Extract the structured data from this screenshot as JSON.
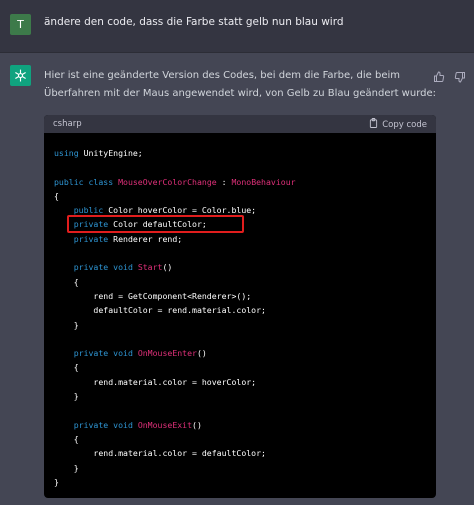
{
  "user": {
    "avatar_letter": "T",
    "message": "ändere den code, dass die Farbe statt gelb nun blau wird"
  },
  "assistant": {
    "message": "Hier ist eine geänderte Version des Codes, bei dem die Farbe, die beim Überfahren mit der Maus angewendet wird, von Gelb zu Blau geändert wurde:",
    "icons": {
      "avatar": "openai-logo-icon",
      "thumbs_up": "thumbs-up-icon",
      "thumbs_down": "thumbs-down-icon"
    }
  },
  "code": {
    "language": "csharp",
    "copy_label": "Copy code",
    "copy_icon": "clipboard-icon",
    "colors": {
      "keyword": "#2e95d3",
      "class": "#df3079",
      "plain": "#ffffff",
      "highlight_box": "#e11d1d"
    },
    "lines": [
      [
        {
          "t": "using",
          "c": "kw"
        },
        {
          "t": " UnityEngine;"
        }
      ],
      [],
      [
        {
          "t": "public class",
          "c": "kw"
        },
        {
          "t": " "
        },
        {
          "t": "MouseOverColorChange",
          "c": "cls"
        },
        {
          "t": " : "
        },
        {
          "t": "MonoBehaviour",
          "c": "cls"
        }
      ],
      [
        {
          "t": "{"
        }
      ],
      [
        {
          "t": "    "
        },
        {
          "t": "public",
          "c": "kw"
        },
        {
          "t": " Color hoverColor = Color.blue;"
        }
      ],
      [
        {
          "t": "    "
        },
        {
          "t": "private",
          "c": "kw"
        },
        {
          "t": " Color defaultColor;"
        }
      ],
      [
        {
          "t": "    "
        },
        {
          "t": "private",
          "c": "kw"
        },
        {
          "t": " Renderer rend;"
        }
      ],
      [],
      [
        {
          "t": "    "
        },
        {
          "t": "private void",
          "c": "kw"
        },
        {
          "t": " "
        },
        {
          "t": "Start",
          "c": "cls"
        },
        {
          "t": "()"
        }
      ],
      [
        {
          "t": "    {"
        }
      ],
      [
        {
          "t": "        rend = GetComponent<Renderer>();"
        }
      ],
      [
        {
          "t": "        defaultColor = rend.material.color;"
        }
      ],
      [
        {
          "t": "    }"
        }
      ],
      [],
      [
        {
          "t": "    "
        },
        {
          "t": "private void",
          "c": "kw"
        },
        {
          "t": " "
        },
        {
          "t": "OnMouseEnter",
          "c": "cls"
        },
        {
          "t": "()"
        }
      ],
      [
        {
          "t": "    {"
        }
      ],
      [
        {
          "t": "        rend.material.color = hoverColor;"
        }
      ],
      [
        {
          "t": "    }"
        }
      ],
      [],
      [
        {
          "t": "    "
        },
        {
          "t": "private void",
          "c": "kw"
        },
        {
          "t": " "
        },
        {
          "t": "OnMouseExit",
          "c": "cls"
        },
        {
          "t": "()"
        }
      ],
      [
        {
          "t": "    {"
        }
      ],
      [
        {
          "t": "        rend.material.color = defaultColor;"
        }
      ],
      [
        {
          "t": "    }"
        }
      ],
      [
        {
          "t": "}"
        }
      ]
    ]
  }
}
